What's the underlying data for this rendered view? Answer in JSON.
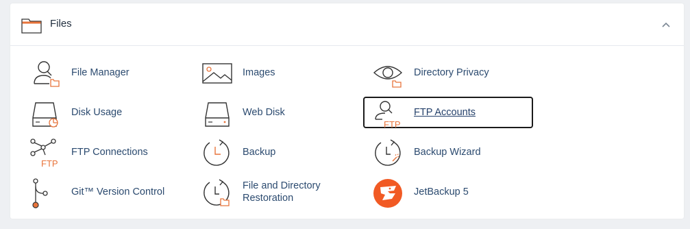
{
  "section": {
    "title": "Files",
    "accent": "#e8743b",
    "icon_stroke": "#333333"
  },
  "items": [
    {
      "label": "File Manager",
      "icon": "file-manager-icon"
    },
    {
      "label": "Images",
      "icon": "images-icon"
    },
    {
      "label": "Directory Privacy",
      "icon": "directory-privacy-icon"
    },
    {
      "label": "Disk Usage",
      "icon": "disk-usage-icon"
    },
    {
      "label": "Web Disk",
      "icon": "web-disk-icon"
    },
    {
      "label": "FTP Accounts",
      "icon": "ftp-accounts-icon",
      "selected": true
    },
    {
      "label": "FTP Connections",
      "icon": "ftp-connections-icon"
    },
    {
      "label": "Backup",
      "icon": "backup-icon"
    },
    {
      "label": "Backup Wizard",
      "icon": "backup-wizard-icon"
    },
    {
      "label": "Git™ Version Control",
      "icon": "git-icon"
    },
    {
      "label": "File and Directory\nRestoration",
      "icon": "restoration-icon"
    },
    {
      "label": "JetBackup 5",
      "icon": "jetbackup-icon"
    }
  ],
  "icon_text": {
    "ftp": "FTP"
  }
}
